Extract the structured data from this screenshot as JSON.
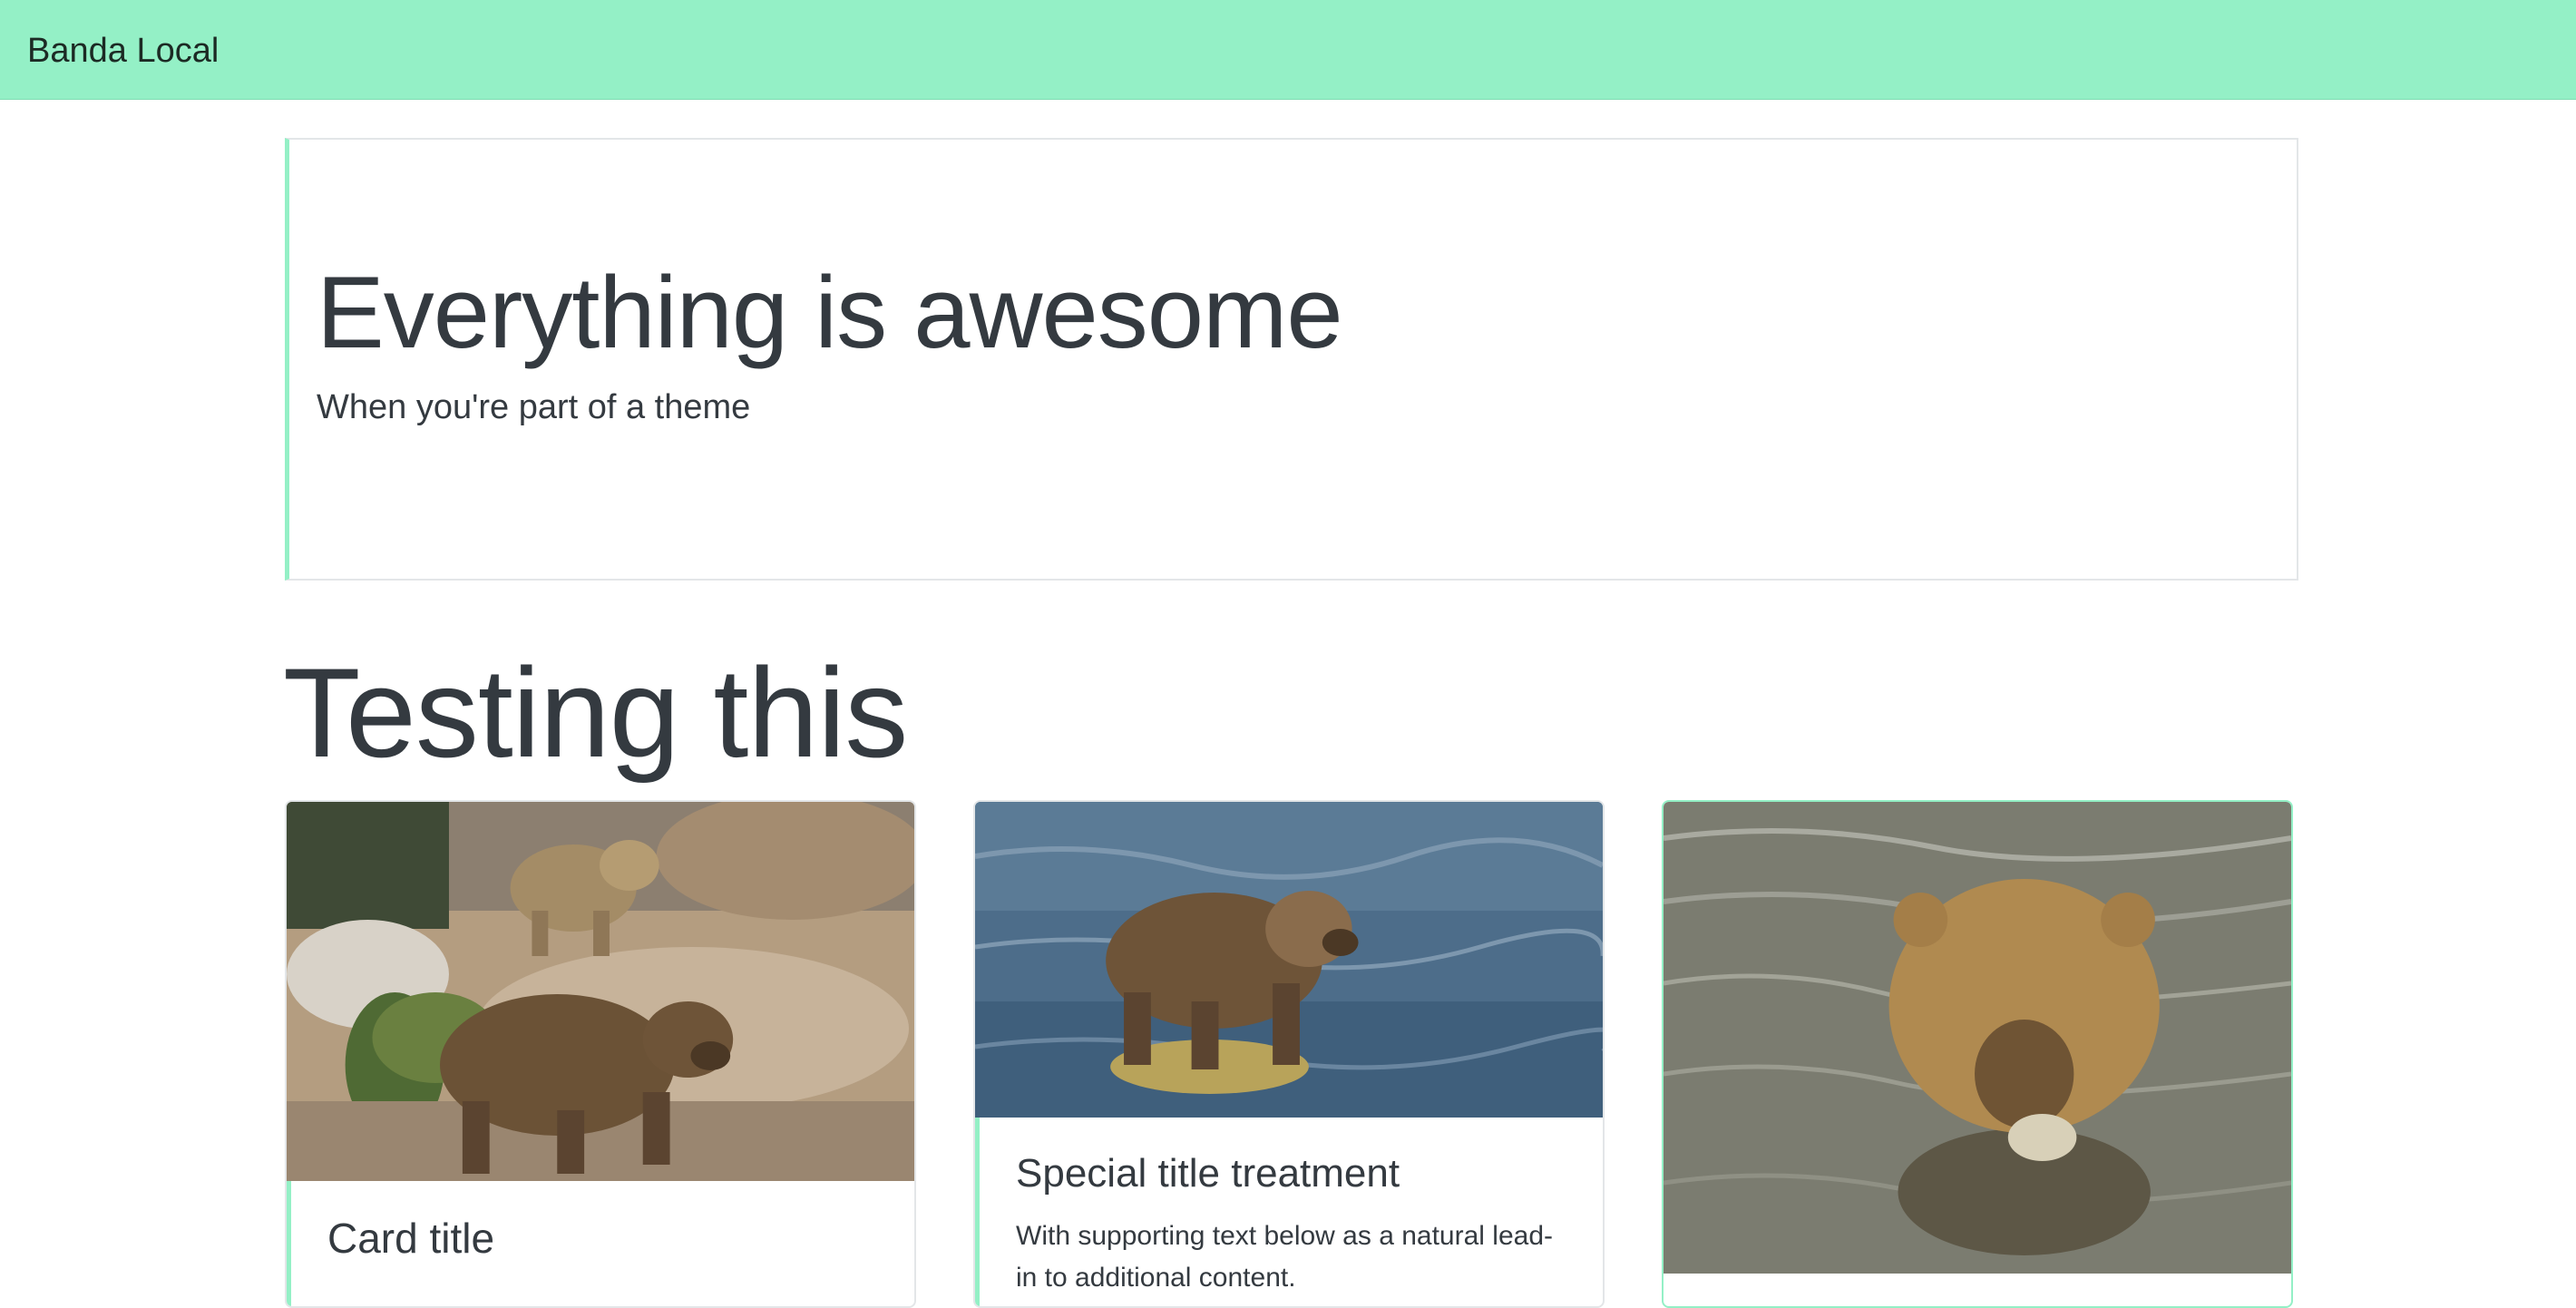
{
  "navbar": {
    "brand": "Banda Local"
  },
  "jumbotron": {
    "title": "Everything is awesome",
    "subtitle": "When you're part of a theme"
  },
  "section": {
    "title": "Testing this"
  },
  "cards": [
    {
      "title": "Card title",
      "image": "bears-on-rocks-photo"
    },
    {
      "title": "Special title treatment",
      "text": "With supporting text below as a natural lead-in to additional content.",
      "image": "bear-standing-in-river-photo"
    },
    {
      "image": "bear-in-water-eating-photo"
    }
  ],
  "colors": {
    "accent": "#94f0c6",
    "text": "#343a40",
    "border": "#e3e6e8"
  }
}
